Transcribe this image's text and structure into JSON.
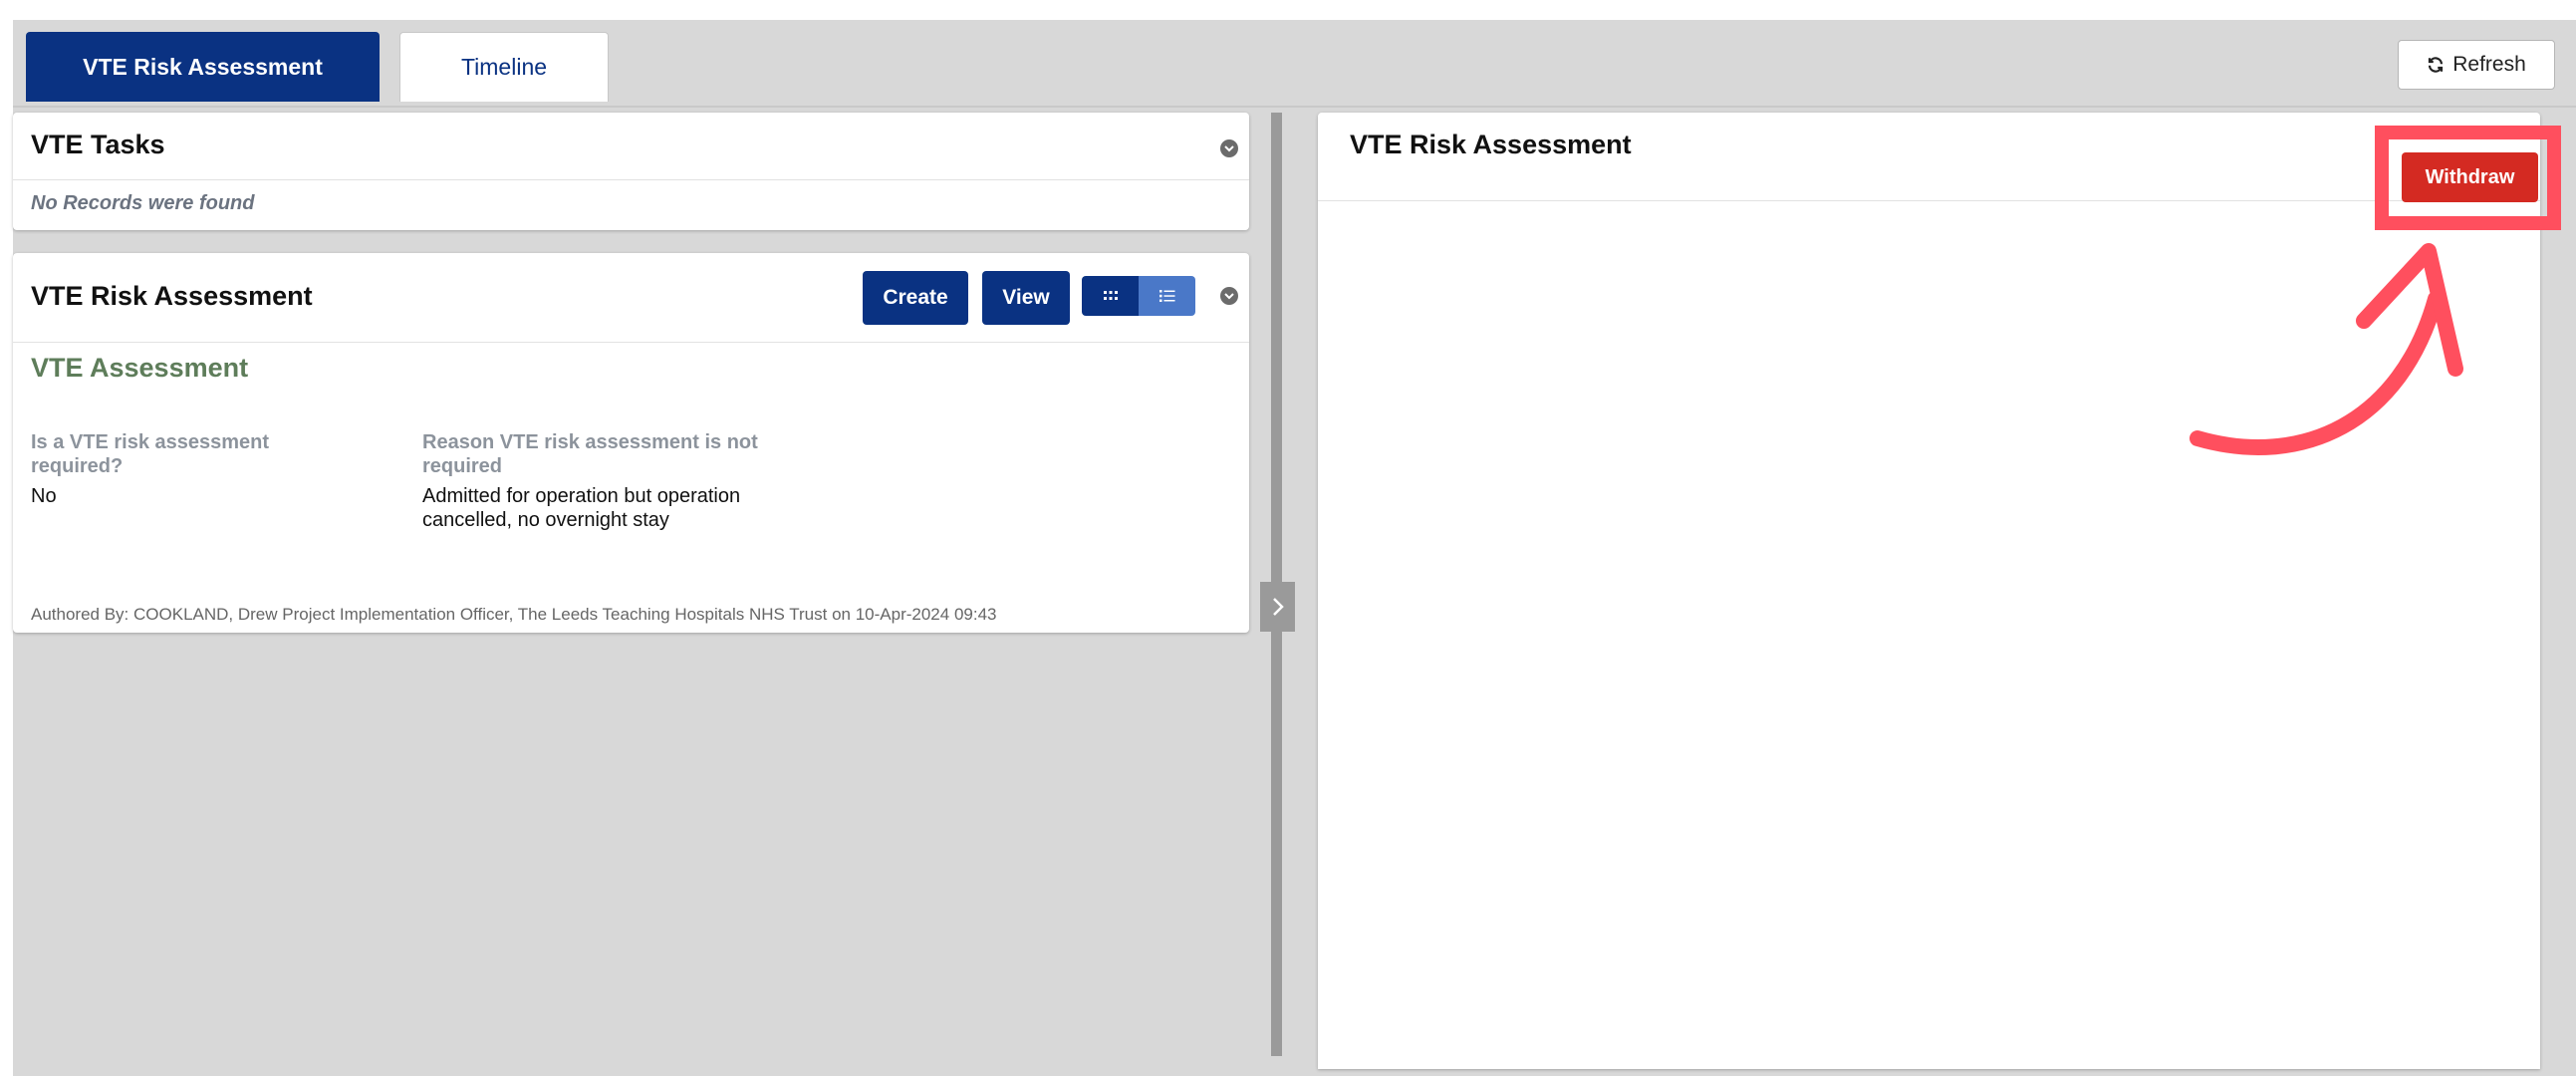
{
  "tabs": [
    {
      "label": "VTE Risk Assessment",
      "active": true
    },
    {
      "label": "Timeline",
      "active": false
    }
  ],
  "toolbar": {
    "refresh_label": "Refresh",
    "refresh_icon": "refresh-icon"
  },
  "tasks_panel": {
    "title": "VTE Tasks",
    "empty_message": "No Records were found"
  },
  "risk_panel": {
    "title": "VTE Risk Assessment",
    "create_label": "Create",
    "view_label": "View",
    "section_title": "VTE Assessment",
    "fields": [
      {
        "label": "Is a VTE risk assessment required?",
        "value": "No"
      },
      {
        "label": "Reason VTE risk assessment is not required",
        "value": "Admitted for operation but operation cancelled, no overnight stay"
      }
    ],
    "authored_by": "Authored By: COOKLAND, Drew Project Implementation Officer, The Leeds Teaching Hospitals NHS Trust on 10-Apr-2024 09:43"
  },
  "detail_panel": {
    "title": "VTE Risk Assessment",
    "withdraw_label": "Withdraw"
  },
  "colors": {
    "primary": "#0a3282",
    "withdraw": "#d42a22",
    "annotation": "#ff4f5e",
    "section_title": "#5e7d5a"
  }
}
